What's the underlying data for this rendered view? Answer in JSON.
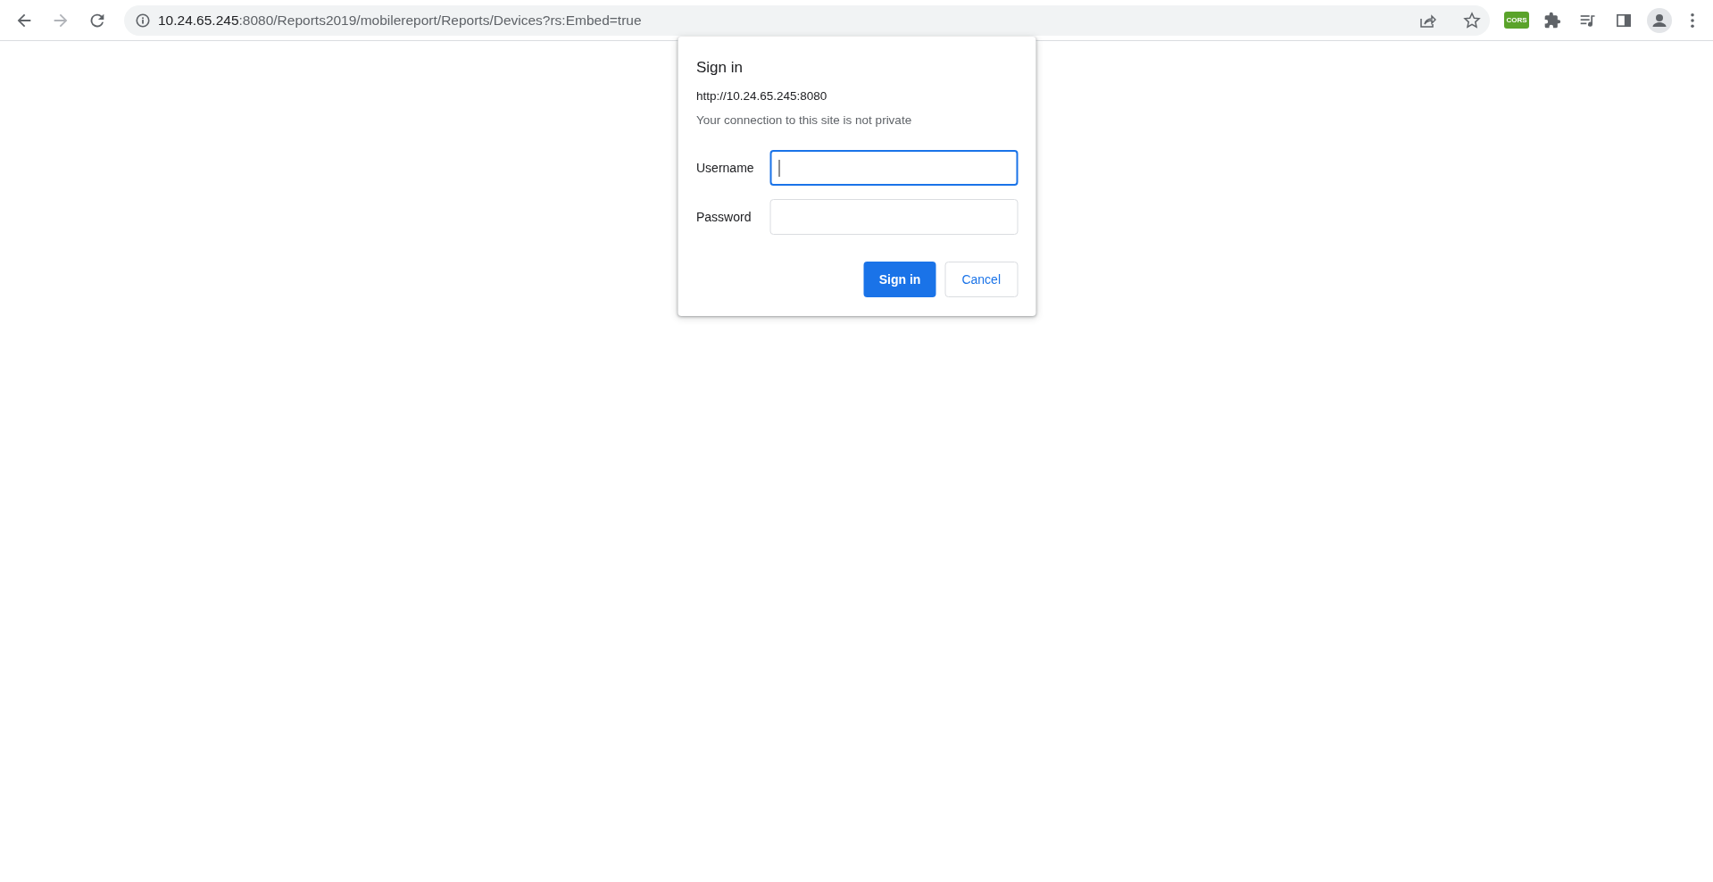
{
  "toolbar": {
    "nav_buttons": [
      {
        "kind": "back",
        "disabled": false
      },
      {
        "kind": "forward",
        "disabled": true
      },
      {
        "kind": "reload",
        "disabled": false
      }
    ],
    "address_bar": {
      "host": "10.24.65.245",
      "path": ":8080/Reports2019/mobilereport/Reports/Devices?rs:Embed=true"
    },
    "extensions": [
      {
        "label": "CORS"
      }
    ]
  },
  "dialog": {
    "title": "Sign in",
    "origin": "http://10.24.65.245:8080",
    "warning": "Your connection to this site is not private",
    "fields": [
      {
        "label": "Username",
        "focused": true
      },
      {
        "label": "Password",
        "focused": false
      }
    ],
    "buttons": [
      {
        "label": "Sign in",
        "kind": "primary"
      },
      {
        "label": "Cancel",
        "kind": "secondary"
      }
    ]
  }
}
